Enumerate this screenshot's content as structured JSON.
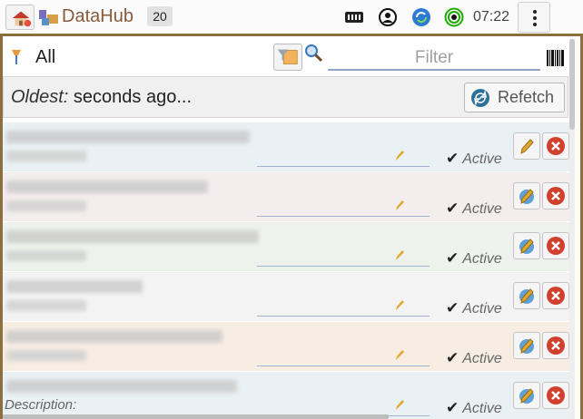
{
  "app": {
    "title": "DataHub",
    "count": "20",
    "clock": "07:22",
    "brand_color": "#8a5a3c",
    "frame_color": "#8d6e3f"
  },
  "toolbar_icons": [
    "home-logo-icon",
    "app-icon",
    "signal-icon",
    "user-icon",
    "sync-icon",
    "broadcast-icon",
    "kebab-menu-icon"
  ],
  "filter": {
    "scope_label": "All",
    "placeholder": "Filter",
    "value": ""
  },
  "oldest": {
    "label": "Oldest:",
    "value": "seconds ago..."
  },
  "refetch": {
    "label": "Refetch"
  },
  "rows": [
    {
      "status": "Active",
      "bg": "#e9f1f4",
      "edit_icon": "pencil-icon"
    },
    {
      "status": "Active",
      "bg": "#f4edee",
      "edit_icon": "edit-disabled-icon"
    },
    {
      "status": "Active",
      "bg": "#edf3ec",
      "edit_icon": "edit-disabled-icon"
    },
    {
      "status": "Active",
      "bg": "#f3f3f3",
      "edit_icon": "edit-disabled-icon"
    },
    {
      "status": "Active",
      "bg": "#f7ede3",
      "edit_icon": "edit-disabled-icon"
    },
    {
      "status": "Active",
      "bg": "#e9f1f4",
      "edit_icon": "edit-disabled-icon",
      "description_label": "Description:"
    }
  ]
}
